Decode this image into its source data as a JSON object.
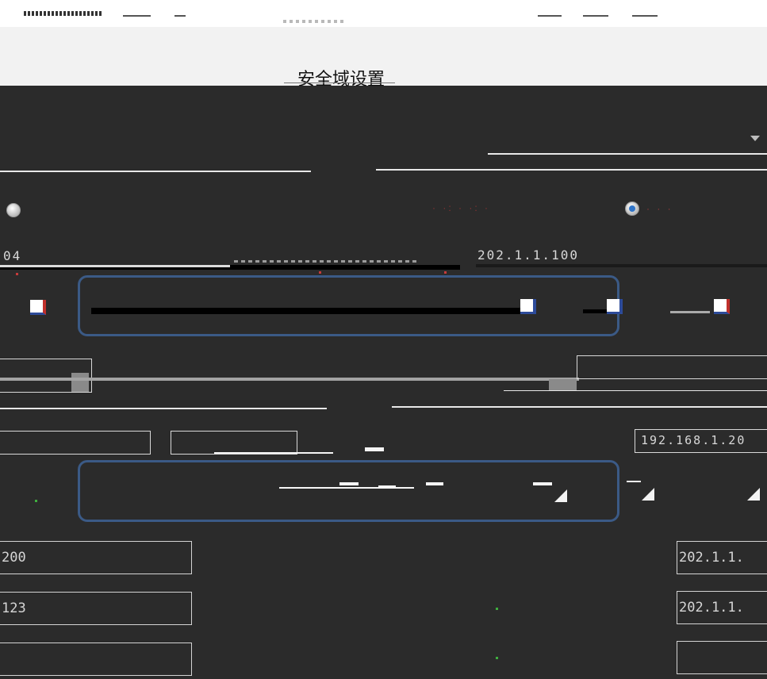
{
  "header": {
    "page_title": "安全域设置"
  },
  "rows": {
    "ip_top_right": "202.1.1.100",
    "ip_mid_left": "04",
    "ip_mid_right": "192.168.1.20"
  },
  "radios": {
    "left_checked": false,
    "right_checked": true
  },
  "fields": {
    "left_1": "200",
    "left_2": "123",
    "left_3": "",
    "right_1": "202.1.1.",
    "right_2": "202.1.1.",
    "right_3": ""
  },
  "colors": {
    "background": "#2b2b2b",
    "header_bg": "#f2f2f2",
    "highlight_border": "#3b5a86",
    "radio_selected": "#2f74c8"
  }
}
